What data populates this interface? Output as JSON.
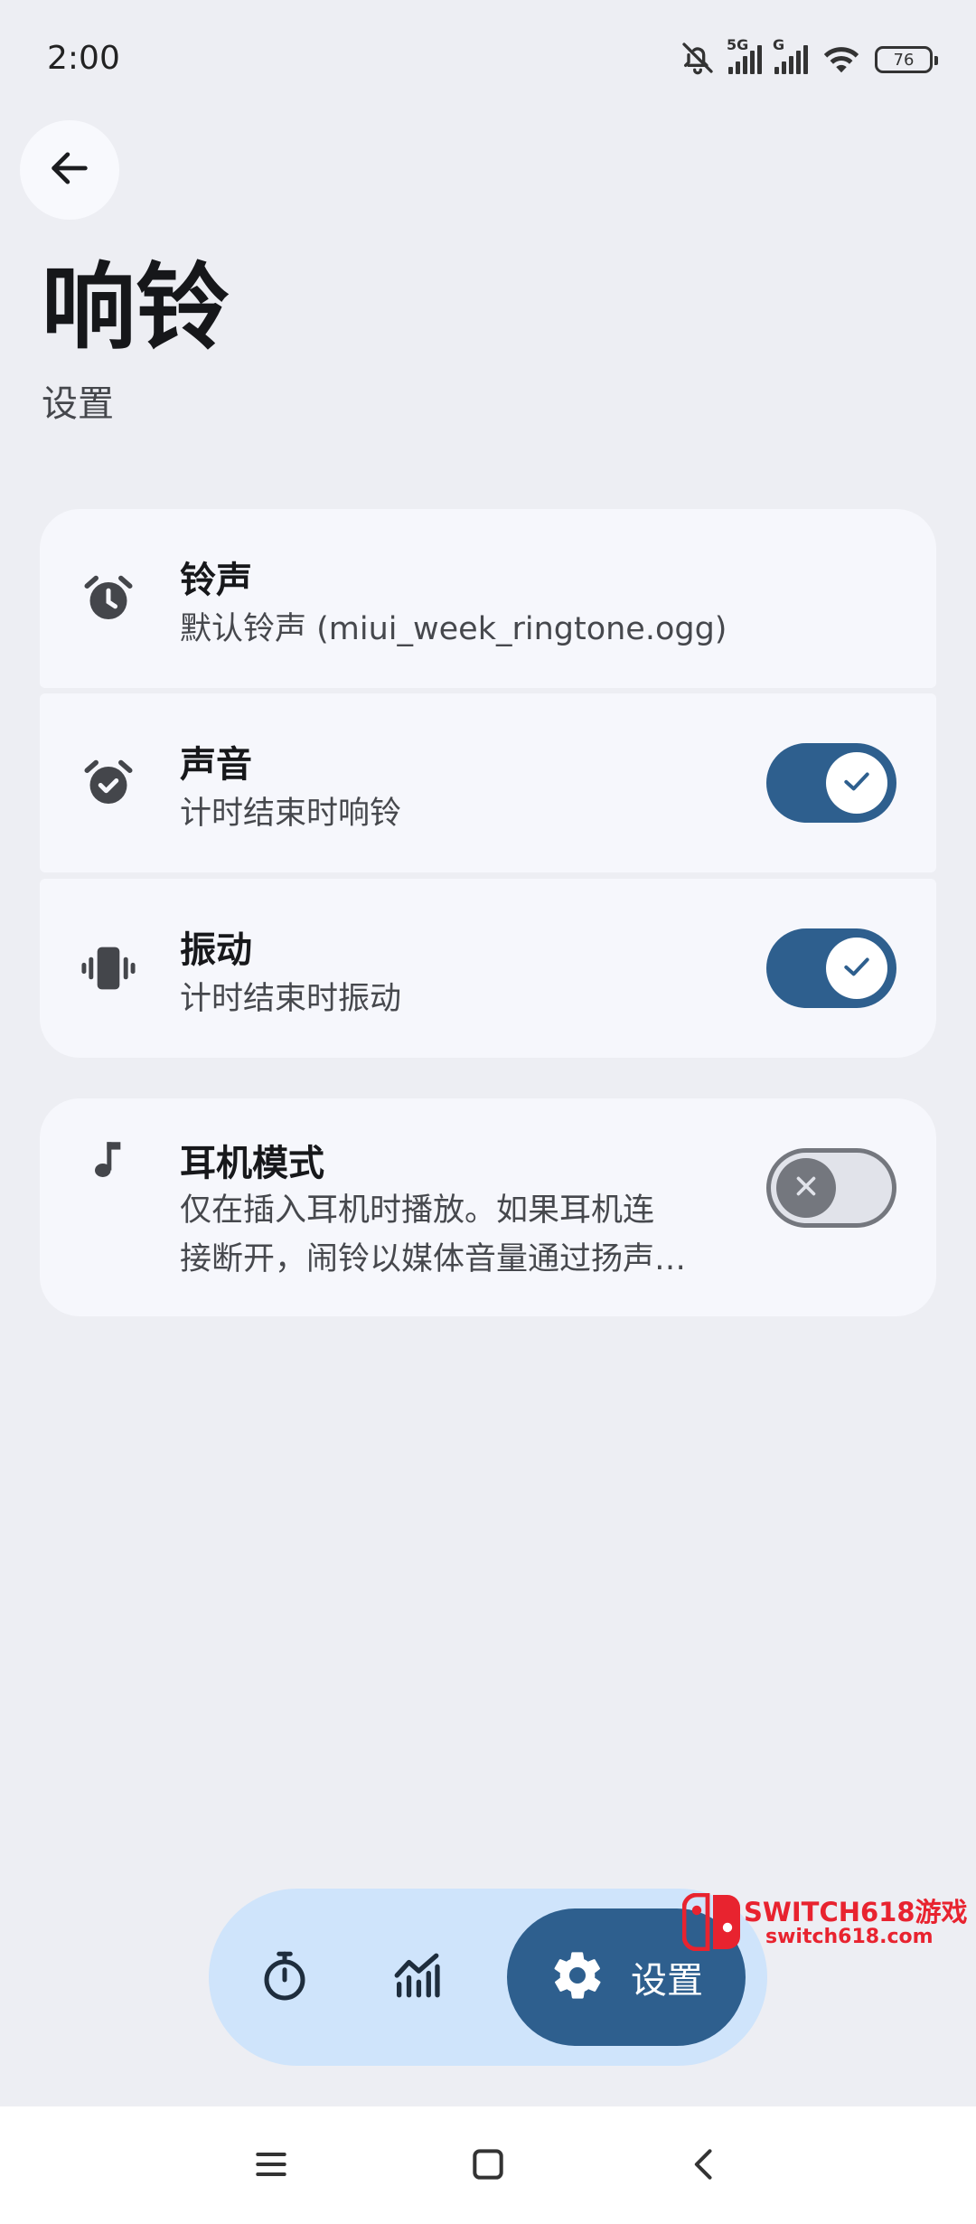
{
  "status_bar": {
    "time": "2:00",
    "signal1_label": "5G",
    "signal2_label": "G",
    "battery": "76"
  },
  "header": {
    "title": "响铃",
    "subtitle": "设置"
  },
  "settings": {
    "ringtone": {
      "title": "铃声",
      "subtitle": "默认铃声 (miui_week_ringtone.ogg)",
      "icon": "alarm-clock-icon"
    },
    "sound": {
      "title": "声音",
      "subtitle": "计时结束时响铃",
      "enabled": true,
      "icon": "alarm-check-icon"
    },
    "vibration": {
      "title": "振动",
      "subtitle": "计时结束时振动",
      "enabled": true,
      "icon": "vibrate-icon"
    },
    "headphone": {
      "title": "耳机模式",
      "subtitle_line1": "仅在插入耳机时播放。如果耳机连",
      "subtitle_line2": "接断开，闹铃以媒体音量通过扬声…",
      "enabled": false,
      "icon": "music-note-icon"
    }
  },
  "bottom_nav": {
    "items": [
      {
        "icon": "stopwatch-icon"
      },
      {
        "icon": "chart-icon"
      },
      {
        "icon": "gear-icon",
        "label": "设置",
        "active": true
      }
    ]
  },
  "watermark": {
    "brand": "SWITCH618游戏",
    "url": "switch618.com"
  },
  "colors": {
    "accent": "#2e5f8e",
    "background": "#edeef3",
    "card": "#f6f7fc",
    "nav_pill": "#cfe4fb"
  }
}
